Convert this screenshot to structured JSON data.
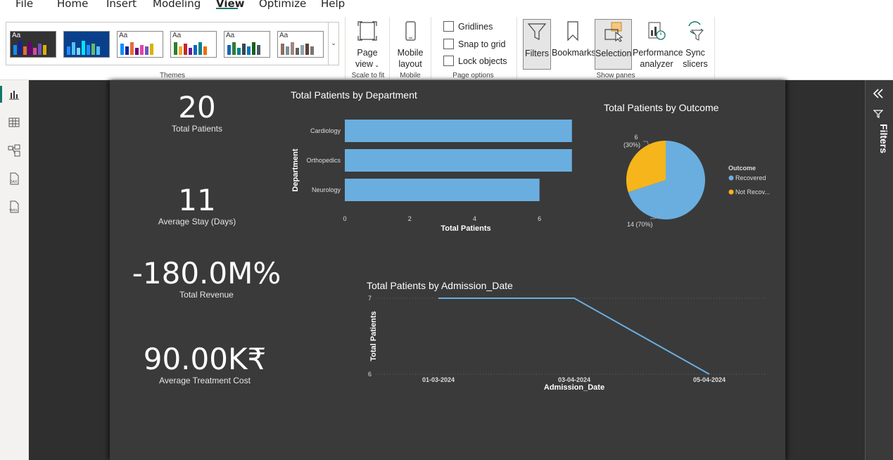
{
  "menu": {
    "items": [
      "File",
      "Home",
      "Insert",
      "Modeling",
      "View",
      "Optimize",
      "Help"
    ],
    "active": "View"
  },
  "ribbon": {
    "themes_label": "Themes",
    "page_view": {
      "line1": "Page",
      "line2": "view"
    },
    "scale_label": "Scale to fit",
    "mobile_layout": {
      "line1": "Mobile",
      "line2": "layout"
    },
    "mobile_label": "Mobile",
    "gridlines": "Gridlines",
    "snap_to_grid": "Snap to grid",
    "lock_objects": "Lock objects",
    "page_options_label": "Page options",
    "filters": "Filters",
    "bookmarks": "Bookmarks",
    "selection": "Selection",
    "performance": {
      "line1": "Performance",
      "line2": "analyzer"
    },
    "sync": {
      "line1": "Sync",
      "line2": "slicers"
    },
    "show_panes_label": "Show panes",
    "theme_aa": "Aa"
  },
  "cards": {
    "total_patients": {
      "value": "20",
      "label": "Total Patients"
    },
    "avg_stay": {
      "value": "11",
      "label": "Average Stay (Days)"
    },
    "total_revenue": {
      "value": "-180.0M%",
      "label": "Total Revenue"
    },
    "avg_cost": {
      "value": "90.00K₹",
      "label": "Average Treatment Cost"
    }
  },
  "filters_pane": {
    "label": "Filters"
  },
  "colors": {
    "bar": "#6aaee0",
    "recovered": "#6aaee0",
    "not_recovered": "#f5b51b",
    "line": "#6aaee0",
    "accent": "#117865"
  },
  "chart_data": [
    {
      "type": "bar",
      "title": "Total Patients by Department",
      "xlabel": "Total Patients",
      "ylabel": "Department",
      "categories": [
        "Cardiology",
        "Orthopedics",
        "Neurology"
      ],
      "values": [
        7,
        7,
        6
      ],
      "xticks": [
        "0",
        "2",
        "4",
        "6"
      ],
      "xlim": [
        0,
        7.2
      ]
    },
    {
      "type": "pie",
      "title": "Total Patients by Outcome",
      "legend_title": "Outcome",
      "slices": [
        {
          "label": "Recovered",
          "value": 14,
          "data_label": "14 (70%)"
        },
        {
          "label": "Not Recovered",
          "legend_text": "Not Recov...",
          "value": 6,
          "data_label_line1": "6",
          "data_label_line2": "(30%)"
        }
      ]
    },
    {
      "type": "line",
      "title": "Total Patients by Admission_Date",
      "xlabel": "Admission_Date",
      "ylabel": "Total Patients",
      "x": [
        "01-03-2024",
        "03-04-2024",
        "05-04-2024"
      ],
      "y": [
        7,
        7,
        6
      ],
      "yticks": [
        "7",
        "6"
      ],
      "ylim": [
        6,
        7
      ]
    }
  ]
}
